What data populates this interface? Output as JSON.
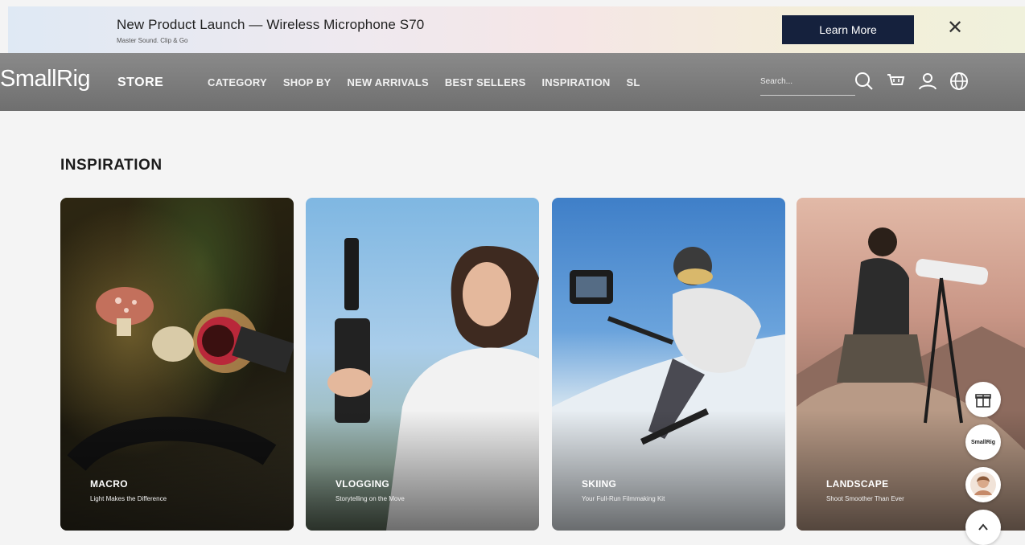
{
  "promo": {
    "title": "New Product Launch — Wireless Microphone S70",
    "subtitle": "Master Sound. Clip & Go",
    "cta_label": "Learn More",
    "close_glyph": "✕"
  },
  "nav": {
    "logo": "SmallRig",
    "store_label": "STORE",
    "items": [
      {
        "label": "CATEGORY"
      },
      {
        "label": "SHOP BY"
      },
      {
        "label": "NEW ARRIVALS"
      },
      {
        "label": "BEST SELLERS"
      },
      {
        "label": "INSPIRATION"
      },
      {
        "label": "SL"
      }
    ],
    "search_placeholder": "Search...",
    "icons": [
      "search-icon",
      "cart-icon",
      "user-icon",
      "globe-icon"
    ]
  },
  "section": {
    "title": "INSPIRATION"
  },
  "cards": [
    {
      "title": "MACRO",
      "subtitle": "Light Makes the Difference"
    },
    {
      "title": "VLOGGING",
      "subtitle": "Storytelling on the Move"
    },
    {
      "title": "SKIING",
      "subtitle": "Your Full-Run Filmmaking Kit"
    },
    {
      "title": "LANDSCAPE",
      "subtitle": "Shoot Smoother Than Ever"
    }
  ],
  "floating": {
    "brand_label": "SmallRig"
  },
  "colors": {
    "cta_bg": "#15213d",
    "nav_bg": "#7c7c7c",
    "page_bg": "#f4f4f4"
  }
}
